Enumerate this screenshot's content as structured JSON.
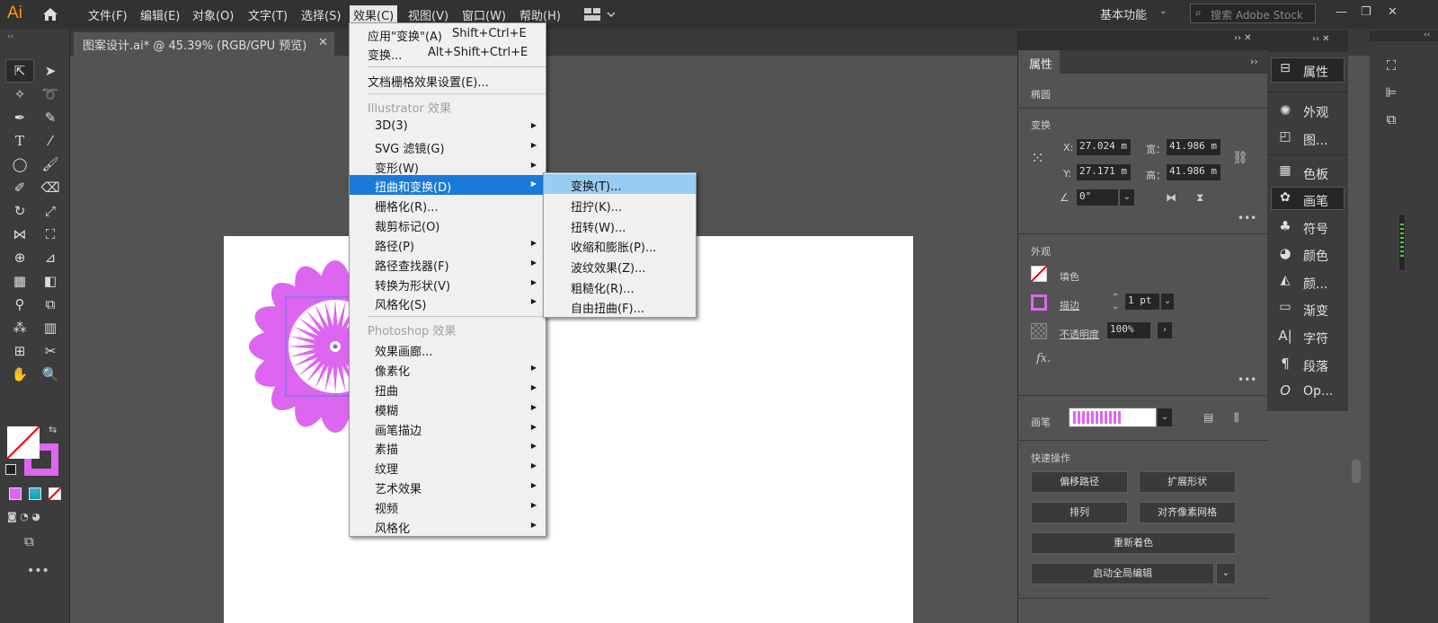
{
  "app": {
    "logo": "Ai"
  },
  "menubar": {
    "items": [
      "文件(F)",
      "编辑(E)",
      "对象(O)",
      "文字(T)",
      "选择(S)",
      "效果(C)",
      "视图(V)",
      "窗口(W)",
      "帮助(H)"
    ],
    "active": "效果(C)",
    "workspace": "基本功能",
    "search_placeholder": "搜索 Adobe Stock"
  },
  "document": {
    "tab": "图案设计.ai* @ 45.39% (RGB/GPU 预览)"
  },
  "effect_menu": {
    "items": [
      {
        "label": "应用\"变换\"(A)",
        "shortcut": "Shift+Ctrl+E"
      },
      {
        "label": "变换...",
        "shortcut": "Alt+Shift+Ctrl+E"
      },
      {
        "label": "文档栅格效果设置(E)..."
      }
    ],
    "illustrator_header": "Illustrator 效果",
    "illustrator_items": [
      "3D(3)",
      "SVG 滤镜(G)",
      "变形(W)",
      "扭曲和变换(D)",
      "栅格化(R)...",
      "裁剪标记(O)",
      "路径(P)",
      "路径查找器(F)",
      "转换为形状(V)",
      "风格化(S)"
    ],
    "highlighted": "扭曲和变换(D)",
    "photoshop_header": "Photoshop 效果",
    "photoshop_items": [
      "效果画廊...",
      "像素化",
      "扭曲",
      "模糊",
      "画笔描边",
      "素描",
      "纹理",
      "艺术效果",
      "视频",
      "风格化"
    ]
  },
  "submenu": {
    "items": [
      "变换(T)...",
      "扭拧(K)...",
      "扭转(W)...",
      "收缩和膨胀(P)...",
      "波纹效果(Z)...",
      "粗糙化(R)...",
      "自由扭曲(F)..."
    ],
    "highlighted": "变换(T)..."
  },
  "properties": {
    "tab": "属性",
    "object": "椭圆",
    "transform_label": "变换",
    "x_label": "X:",
    "x": "27.024 m",
    "y_label": "Y:",
    "y": "27.171 m",
    "w_label": "宽：",
    "w": "41.986 m",
    "h_label": "高：",
    "h": "41.986 m",
    "angle": "0°",
    "appearance_label": "外观",
    "fill_label": "填色",
    "stroke_label": "描边",
    "stroke_value": "1 pt",
    "opacity_label": "不透明度",
    "opacity": "100%",
    "fx": "fx.",
    "brush_label": "画笔",
    "quick_label": "快速操作",
    "buttons": [
      "偏移路径",
      "扩展形状",
      "排列",
      "对齐像素网格",
      "重新着色",
      "启动全局编辑"
    ]
  },
  "panel_strip": {
    "items": [
      "属性",
      "外观",
      "图...",
      "色板",
      "画笔",
      "符号",
      "颜色",
      "颜...",
      "渐变",
      "字符",
      "段落",
      "Op..."
    ]
  },
  "colors": {
    "accent": "#1a7ad9",
    "flower": "#dd66f0",
    "menu_bg": "#f0f0f0"
  }
}
